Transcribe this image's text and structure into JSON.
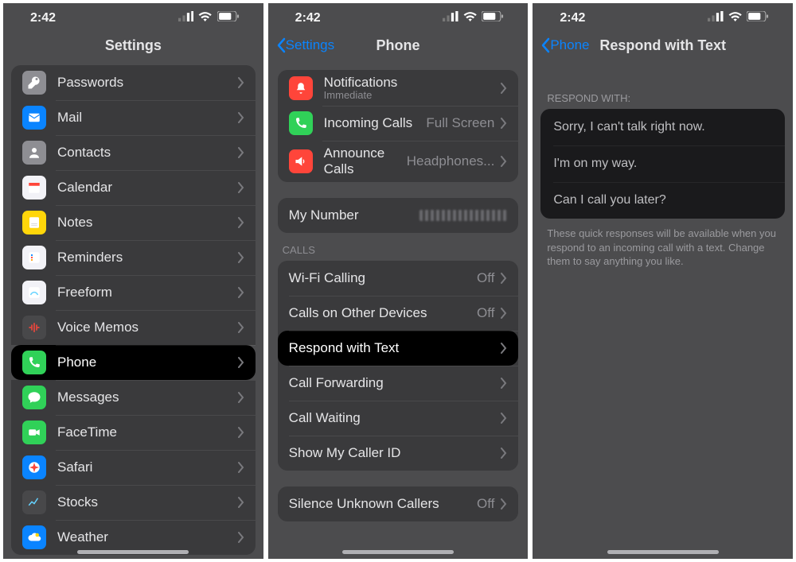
{
  "status": {
    "time": "2:42"
  },
  "screen1": {
    "title": "Settings",
    "items": [
      {
        "label": "Passwords",
        "icon": "key-icon",
        "color": "icon-grey"
      },
      {
        "label": "Mail",
        "icon": "envelope-icon",
        "color": "icon-blue"
      },
      {
        "label": "Contacts",
        "icon": "person-icon",
        "color": "icon-grey"
      },
      {
        "label": "Calendar",
        "icon": "calendar-icon",
        "color": "icon-white"
      },
      {
        "label": "Notes",
        "icon": "note-icon",
        "color": "icon-yellow"
      },
      {
        "label": "Reminders",
        "icon": "list-icon",
        "color": "icon-white"
      },
      {
        "label": "Freeform",
        "icon": "freeform-icon",
        "color": "icon-white"
      },
      {
        "label": "Voice Memos",
        "icon": "waveform-icon",
        "color": "icon-darkgrey"
      },
      {
        "label": "Phone",
        "icon": "phone-icon",
        "color": "icon-green",
        "highlight": true
      },
      {
        "label": "Messages",
        "icon": "message-icon",
        "color": "icon-green"
      },
      {
        "label": "FaceTime",
        "icon": "video-icon",
        "color": "icon-green"
      },
      {
        "label": "Safari",
        "icon": "compass-icon",
        "color": "icon-blue"
      },
      {
        "label": "Stocks",
        "icon": "chart-icon",
        "color": "icon-darkgrey"
      },
      {
        "label": "Weather",
        "icon": "cloud-icon",
        "color": "icon-blue"
      }
    ]
  },
  "screen2": {
    "back": "Settings",
    "title": "Phone",
    "top_items": [
      {
        "label": "Notifications",
        "sub": "Immediate",
        "icon": "bell-icon",
        "color": "icon-red"
      },
      {
        "label": "Incoming Calls",
        "value": "Full Screen",
        "icon": "incoming-icon",
        "color": "icon-green"
      },
      {
        "label": "Announce Calls",
        "value": "Headphones...",
        "icon": "announce-icon",
        "color": "icon-red"
      }
    ],
    "my_number_label": "My Number",
    "calls_header": "CALLS",
    "calls_items": [
      {
        "label": "Wi-Fi Calling",
        "value": "Off"
      },
      {
        "label": "Calls on Other Devices",
        "value": "Off"
      },
      {
        "label": "Respond with Text",
        "highlight": true
      },
      {
        "label": "Call Forwarding"
      },
      {
        "label": "Call Waiting"
      },
      {
        "label": "Show My Caller ID"
      }
    ],
    "bottom_items": [
      {
        "label": "Silence Unknown Callers",
        "value": "Off"
      }
    ]
  },
  "screen3": {
    "back": "Phone",
    "title": "Respond with Text",
    "header": "RESPOND WITH:",
    "responses": [
      "Sorry, I can't talk right now.",
      "I'm on my way.",
      "Can I call you later?"
    ],
    "footer": "These quick responses will be available when you respond to an incoming call with a text. Change them to say anything you like."
  }
}
